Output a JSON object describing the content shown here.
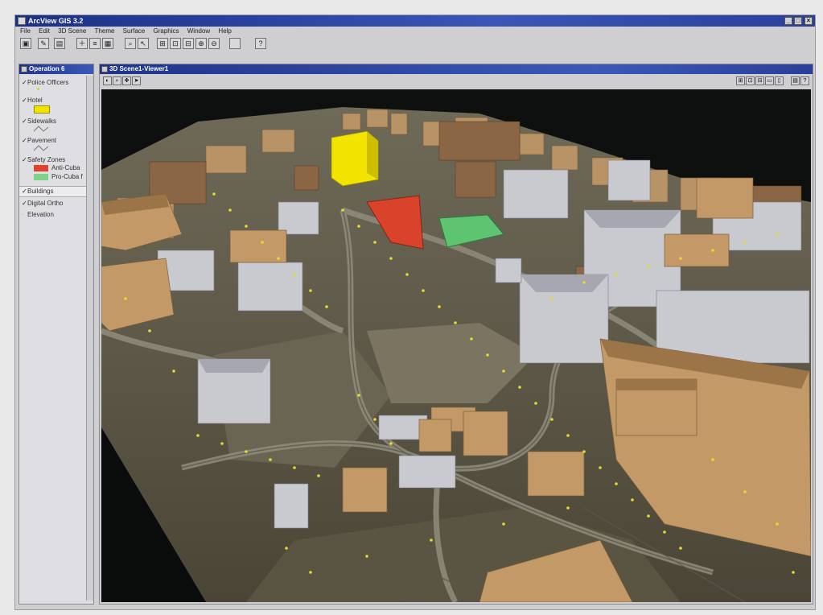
{
  "app": {
    "title": "ArcView GIS 3.2",
    "menus": [
      "File",
      "Edit",
      "3D Scene",
      "Theme",
      "Surface",
      "Graphics",
      "Window",
      "Help"
    ]
  },
  "toc": {
    "title": "Operation 6",
    "themes": [
      {
        "label": "Police Officers",
        "checked": true
      },
      {
        "label": "Hotel",
        "checked": true
      },
      {
        "label": "Sidewalks",
        "checked": true
      },
      {
        "label": "Pavement",
        "checked": true
      },
      {
        "label": "Safety Zones",
        "checked": true
      },
      {
        "label": "Anti-Cuba",
        "checked": false
      },
      {
        "label": "Pro-Cuba f",
        "checked": false
      },
      {
        "label": "Buildings",
        "checked": true
      },
      {
        "label": "Digital Ortho",
        "checked": true
      },
      {
        "label": "Elevation",
        "checked": false
      }
    ],
    "colors": {
      "hotel": "#f2e300",
      "anti_cuba": "#e0432a",
      "pro_cuba": "#6ccf7a",
      "police": "#d9d21a"
    }
  },
  "viewer": {
    "title": "3D Scene1-Viewer1"
  }
}
